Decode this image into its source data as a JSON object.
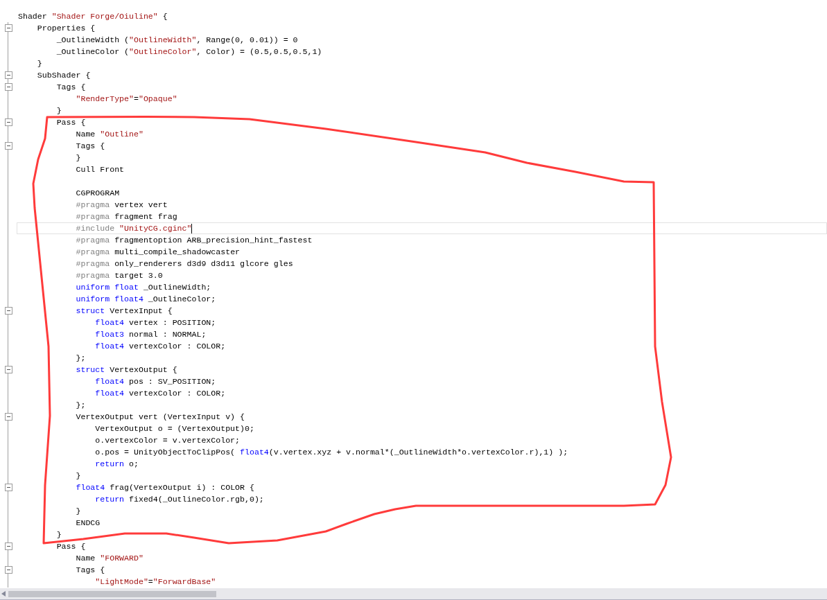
{
  "editor": {
    "lines": [
      {
        "kind": "line",
        "current": false,
        "tokens": [
          {
            "text": "Shader ",
            "kind": "plain"
          },
          {
            "text": "\"Shader Forge/Oiuline\"",
            "kind": "string"
          },
          {
            "text": " {",
            "kind": "plain"
          }
        ]
      },
      {
        "kind": "fold",
        "current": false,
        "tokens": [
          {
            "text": "    Properties {",
            "kind": "plain"
          }
        ]
      },
      {
        "kind": "line",
        "current": false,
        "tokens": [
          {
            "text": "        _OutlineWidth (",
            "kind": "plain"
          },
          {
            "text": "\"OutlineWidth\"",
            "kind": "string"
          },
          {
            "text": ", Range(0, 0.01)) = 0",
            "kind": "plain"
          }
        ]
      },
      {
        "kind": "line",
        "current": false,
        "tokens": [
          {
            "text": "        _OutlineColor (",
            "kind": "plain"
          },
          {
            "text": "\"OutlineColor\"",
            "kind": "string"
          },
          {
            "text": ", Color) = (0.5,0.5,0.5,1)",
            "kind": "plain"
          }
        ]
      },
      {
        "kind": "line",
        "current": false,
        "tokens": [
          {
            "text": "    }",
            "kind": "plain"
          }
        ]
      },
      {
        "kind": "fold",
        "current": false,
        "tokens": [
          {
            "text": "    SubShader {",
            "kind": "plain"
          }
        ]
      },
      {
        "kind": "fold",
        "current": false,
        "tokens": [
          {
            "text": "        Tags {",
            "kind": "plain"
          }
        ]
      },
      {
        "kind": "line",
        "current": false,
        "tokens": [
          {
            "text": "            \"RenderType\"",
            "kind": "string"
          },
          {
            "text": "=",
            "kind": "plain"
          },
          {
            "text": "\"Opaque\"",
            "kind": "string"
          }
        ]
      },
      {
        "kind": "line",
        "current": false,
        "tokens": [
          {
            "text": "        }",
            "kind": "plain"
          }
        ]
      },
      {
        "kind": "fold",
        "current": false,
        "tokens": [
          {
            "text": "        Pass {",
            "kind": "plain"
          }
        ]
      },
      {
        "kind": "line",
        "current": false,
        "tokens": [
          {
            "text": "            Name ",
            "kind": "plain"
          },
          {
            "text": "\"Outline\"",
            "kind": "string"
          }
        ]
      },
      {
        "kind": "fold",
        "current": false,
        "tokens": [
          {
            "text": "            Tags {",
            "kind": "plain"
          }
        ]
      },
      {
        "kind": "line",
        "current": false,
        "tokens": [
          {
            "text": "            }",
            "kind": "plain"
          }
        ]
      },
      {
        "kind": "line",
        "current": false,
        "tokens": [
          {
            "text": "            Cull Front",
            "kind": "plain"
          }
        ]
      },
      {
        "kind": "line",
        "current": false
      },
      {
        "kind": "line",
        "current": false,
        "tokens": [
          {
            "text": "            CGPROGRAM",
            "kind": "plain"
          }
        ]
      },
      {
        "kind": "line",
        "current": false,
        "tokens": [
          {
            "text": "            #pragma",
            "kind": "directive"
          },
          {
            "text": " vertex vert",
            "kind": "plain"
          }
        ]
      },
      {
        "kind": "line",
        "current": false,
        "tokens": [
          {
            "text": "            #pragma",
            "kind": "directive"
          },
          {
            "text": " fragment frag",
            "kind": "plain"
          }
        ]
      },
      {
        "kind": "line",
        "current": true,
        "tokens": [
          {
            "text": "            #include",
            "kind": "directive"
          },
          {
            "text": " \"UnityCG.cginc\"",
            "kind": "string"
          }
        ]
      },
      {
        "kind": "line",
        "current": false,
        "tokens": [
          {
            "text": "            #pragma",
            "kind": "directive"
          },
          {
            "text": " fragmentoption ARB_precision_hint_fastest",
            "kind": "plain"
          }
        ]
      },
      {
        "kind": "line",
        "current": false,
        "tokens": [
          {
            "text": "            #pragma",
            "kind": "directive"
          },
          {
            "text": " multi_compile_shadowcaster",
            "kind": "plain"
          }
        ]
      },
      {
        "kind": "line",
        "current": false,
        "tokens": [
          {
            "text": "            #pragma",
            "kind": "directive"
          },
          {
            "text": " only_renderers d3d9 d3d11 glcore gles",
            "kind": "plain"
          }
        ]
      },
      {
        "kind": "line",
        "current": false,
        "tokens": [
          {
            "text": "            #pragma",
            "kind": "directive"
          },
          {
            "text": " target 3.0",
            "kind": "plain"
          }
        ]
      },
      {
        "kind": "line",
        "current": false,
        "tokens": [
          {
            "text": "            uniform float",
            "kind": "keyword"
          },
          {
            "text": " _OutlineWidth;",
            "kind": "plain"
          }
        ]
      },
      {
        "kind": "line",
        "current": false,
        "tokens": [
          {
            "text": "            uniform float4",
            "kind": "keyword"
          },
          {
            "text": " _OutlineColor;",
            "kind": "plain"
          }
        ]
      },
      {
        "kind": "fold",
        "current": false,
        "tokens": [
          {
            "text": "            struct",
            "kind": "keyword"
          },
          {
            "text": " VertexInput {",
            "kind": "plain"
          }
        ]
      },
      {
        "kind": "line",
        "current": false,
        "tokens": [
          {
            "text": "                float4",
            "kind": "keyword"
          },
          {
            "text": " vertex : POSITION;",
            "kind": "plain"
          }
        ]
      },
      {
        "kind": "line",
        "current": false,
        "tokens": [
          {
            "text": "                float3",
            "kind": "keyword"
          },
          {
            "text": " normal : NORMAL;",
            "kind": "plain"
          }
        ]
      },
      {
        "kind": "line",
        "current": false,
        "tokens": [
          {
            "text": "                float4",
            "kind": "keyword"
          },
          {
            "text": " vertexColor : COLOR;",
            "kind": "plain"
          }
        ]
      },
      {
        "kind": "line",
        "current": false,
        "tokens": [
          {
            "text": "            };",
            "kind": "plain"
          }
        ]
      },
      {
        "kind": "fold",
        "current": false,
        "tokens": [
          {
            "text": "            struct",
            "kind": "keyword"
          },
          {
            "text": " VertexOutput {",
            "kind": "plain"
          }
        ]
      },
      {
        "kind": "line",
        "current": false,
        "tokens": [
          {
            "text": "                float4",
            "kind": "keyword"
          },
          {
            "text": " pos : SV_POSITION;",
            "kind": "plain"
          }
        ]
      },
      {
        "kind": "line",
        "current": false,
        "tokens": [
          {
            "text": "                float4",
            "kind": "keyword"
          },
          {
            "text": " vertexColor : COLOR;",
            "kind": "plain"
          }
        ]
      },
      {
        "kind": "line",
        "current": false,
        "tokens": [
          {
            "text": "            };",
            "kind": "plain"
          }
        ]
      },
      {
        "kind": "fold",
        "current": false,
        "tokens": [
          {
            "text": "            VertexOutput vert (VertexInput v) {",
            "kind": "plain"
          }
        ]
      },
      {
        "kind": "line",
        "current": false,
        "tokens": [
          {
            "text": "                VertexOutput o = (VertexOutput)0;",
            "kind": "plain"
          }
        ]
      },
      {
        "kind": "line",
        "current": false,
        "tokens": [
          {
            "text": "                o.vertexColor = v.vertexColor;",
            "kind": "plain"
          }
        ]
      },
      {
        "kind": "line",
        "current": false,
        "tokens": [
          {
            "text": "                o.pos = UnityObjectToClipPos( ",
            "kind": "plain"
          },
          {
            "text": "float4",
            "kind": "keyword"
          },
          {
            "text": "(v.vertex.xyz + v.normal*(_OutlineWidth*o.vertexColor.r),1) );",
            "kind": "plain"
          }
        ]
      },
      {
        "kind": "line",
        "current": false,
        "tokens": [
          {
            "text": "                return",
            "kind": "keyword"
          },
          {
            "text": " o;",
            "kind": "plain"
          }
        ]
      },
      {
        "kind": "line",
        "current": false,
        "tokens": [
          {
            "text": "            }",
            "kind": "plain"
          }
        ]
      },
      {
        "kind": "fold",
        "current": false,
        "tokens": [
          {
            "text": "            float4",
            "kind": "keyword"
          },
          {
            "text": " frag(VertexOutput i) : COLOR {",
            "kind": "plain"
          }
        ]
      },
      {
        "kind": "line",
        "current": false,
        "tokens": [
          {
            "text": "                return",
            "kind": "keyword"
          },
          {
            "text": " fixed4(_OutlineColor.rgb,0);",
            "kind": "plain"
          }
        ]
      },
      {
        "kind": "line",
        "current": false,
        "tokens": [
          {
            "text": "            }",
            "kind": "plain"
          }
        ]
      },
      {
        "kind": "line",
        "current": false,
        "tokens": [
          {
            "text": "            ENDCG",
            "kind": "plain"
          }
        ]
      },
      {
        "kind": "line",
        "current": false,
        "tokens": [
          {
            "text": "        }",
            "kind": "plain"
          }
        ]
      },
      {
        "kind": "fold",
        "current": false,
        "tokens": [
          {
            "text": "        Pass {",
            "kind": "plain"
          }
        ]
      },
      {
        "kind": "line",
        "current": false,
        "tokens": [
          {
            "text": "            Name ",
            "kind": "plain"
          },
          {
            "text": "\"FORWARD\"",
            "kind": "string"
          }
        ]
      },
      {
        "kind": "fold",
        "current": false,
        "tokens": [
          {
            "text": "            Tags {",
            "kind": "plain"
          }
        ]
      },
      {
        "kind": "line",
        "current": false,
        "tokens": [
          {
            "text": "                \"LightMode\"",
            "kind": "string"
          },
          {
            "text": "=",
            "kind": "plain"
          },
          {
            "text": "\"ForwardBase\"",
            "kind": "string"
          }
        ]
      }
    ]
  }
}
